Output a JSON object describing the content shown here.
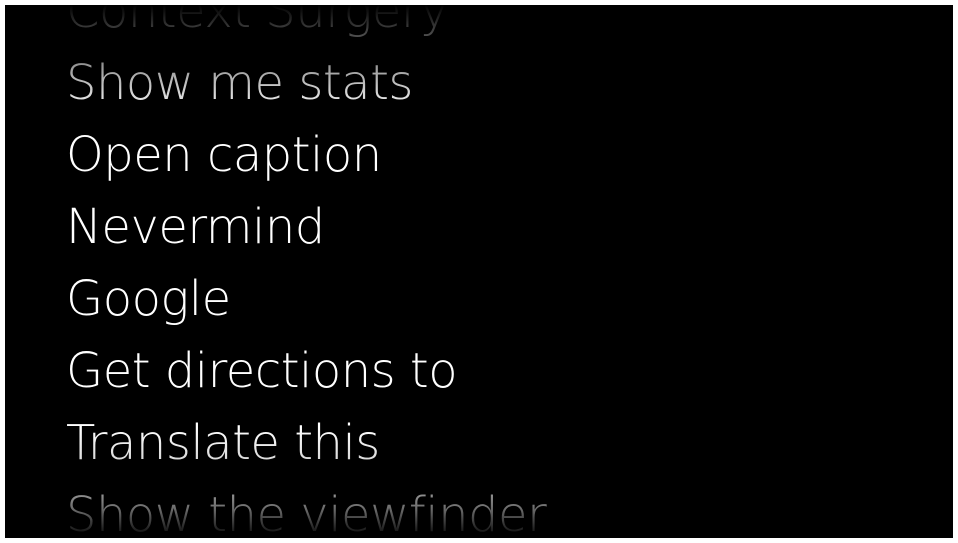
{
  "voice_menu": {
    "items": [
      {
        "label": "Context Surgery"
      },
      {
        "label": "Show me stats"
      },
      {
        "label": "Open caption"
      },
      {
        "label": "Nevermind"
      },
      {
        "label": "Google"
      },
      {
        "label": "Get directions to"
      },
      {
        "label": "Translate this"
      },
      {
        "label": "Show the viewfinder"
      }
    ]
  }
}
